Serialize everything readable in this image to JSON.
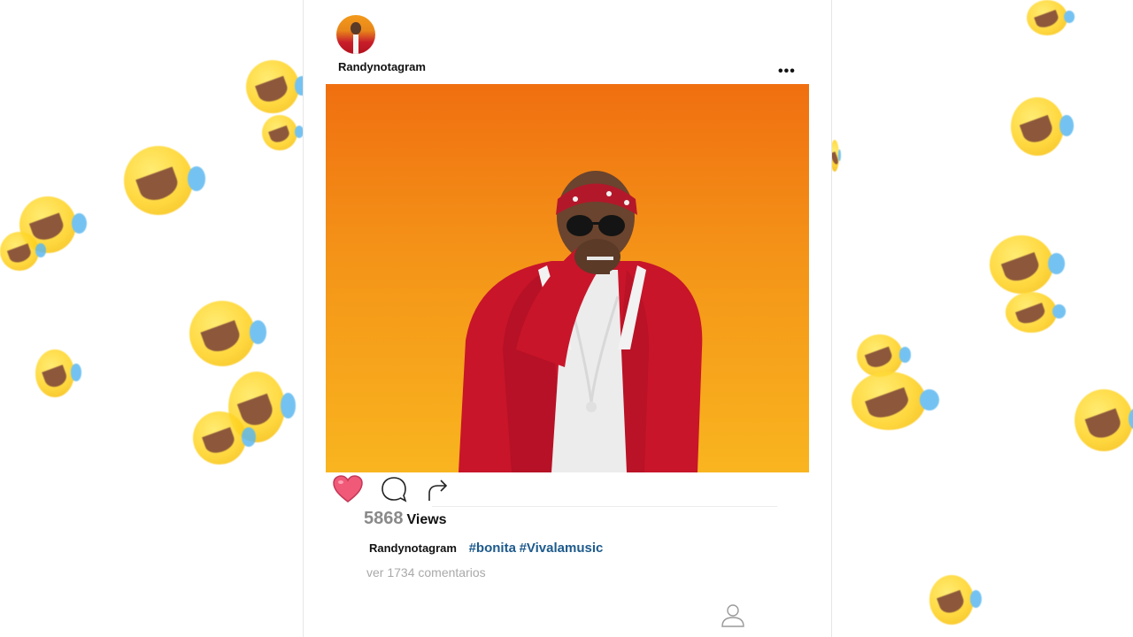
{
  "post": {
    "username": "Randynotagram",
    "more_icon": "more-options-icon",
    "views": {
      "count": "5868",
      "label": "Views"
    },
    "caption": {
      "username": "Randynotagram",
      "hashtags": [
        "#bonita",
        "#Vivalamusic"
      ]
    },
    "comments_link": "ver 1734 comentarios",
    "actions": {
      "like_icon": "heart-icon",
      "comment_icon": "comment-bubble-icon",
      "share_icon": "share-arrow-icon",
      "liked": true
    },
    "bottom_icon": "profile-icon"
  },
  "background": {
    "pattern": "laughing-crying-emoji",
    "colors": {
      "emoji_yellow": "#ffd21f",
      "tear_blue": "#5cb8f0"
    }
  },
  "colors": {
    "heart": "#f05a78",
    "hashtag": "#1d5a8c",
    "photo_top": "#f06f10",
    "photo_bottom": "#f9b51f"
  }
}
